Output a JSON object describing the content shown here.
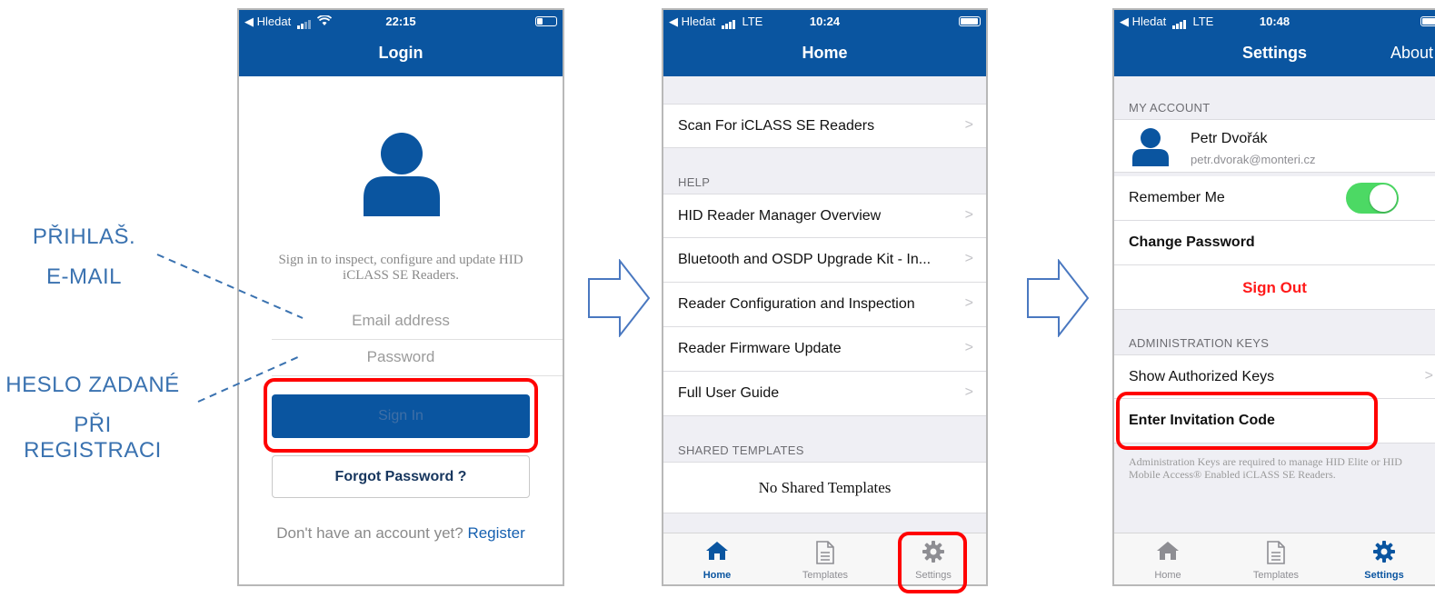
{
  "annotations": {
    "login_email_1": "PŘIHLAŠ.",
    "login_email_2": "E-MAIL",
    "password_1": "HESLO ZADANÉ",
    "password_2": "PŘI REGISTRACI"
  },
  "colors": {
    "brand": "#0a55a0",
    "highlight": "#ff0000",
    "toggle_on": "#4cd964",
    "annotation": "#3a72b0"
  },
  "login_screen": {
    "status": {
      "back": "◀ Hledat",
      "time": "22:15"
    },
    "title": "Login",
    "intro": "Sign in to inspect, configure and update HID iCLASS SE Readers.",
    "email_placeholder": "Email address",
    "password_placeholder": "Password",
    "sign_in": "Sign In",
    "forgot": "Forgot Password ?",
    "no_account": "Don't have an account yet?",
    "register": "Register"
  },
  "home_screen": {
    "status": {
      "back": "◀ Hledat",
      "network": "LTE",
      "time": "10:24"
    },
    "title": "Home",
    "scan_row": "Scan For iCLASS SE Readers",
    "help_header": "HELP",
    "help_items": [
      "HID Reader Manager Overview",
      "Bluetooth and OSDP Upgrade Kit - In...",
      "Reader Configuration and Inspection",
      "Reader Firmware Update",
      "Full User Guide"
    ],
    "shared_header": "SHARED TEMPLATES",
    "no_shared": "No Shared Templates"
  },
  "settings_screen": {
    "status": {
      "back": "◀ Hledat",
      "network": "LTE",
      "time": "10:48"
    },
    "title": "Settings",
    "about": "About",
    "my_account": "MY ACCOUNT",
    "user_name": "Petr Dvořák",
    "user_email": "petr.dvorak@monteri.cz",
    "remember_me": "Remember Me",
    "change_password": "Change Password",
    "sign_out": "Sign Out",
    "admin_keys": "ADMINISTRATION KEYS",
    "show_keys": "Show Authorized Keys",
    "invitation": "Enter Invitation Code",
    "footer": "Administration Keys are required to manage HID Elite or HID Mobile Access® Enabled iCLASS SE Readers."
  },
  "tabs": {
    "home": "Home",
    "templates": "Templates",
    "settings": "Settings"
  },
  "icons": [
    "wifi-icon",
    "signal-bars-icon",
    "battery-icon",
    "user-avatar-icon",
    "chevron-right-icon",
    "home-icon",
    "document-icon",
    "gear-icon",
    "arrow-right-icon"
  ]
}
